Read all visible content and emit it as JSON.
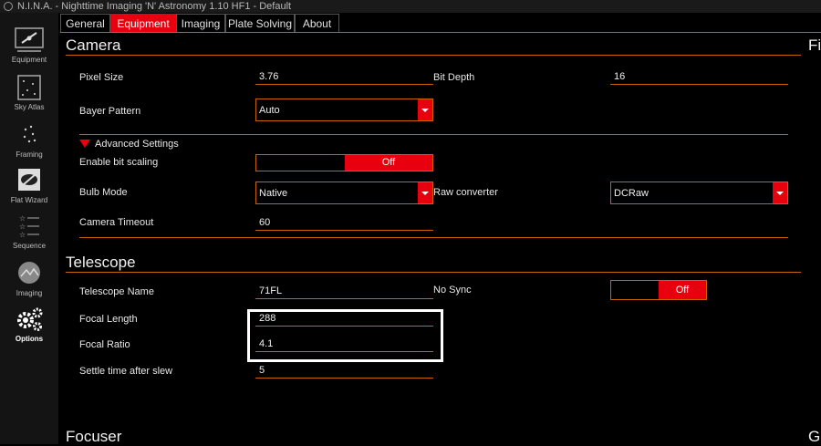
{
  "window": {
    "title": "N.I.N.A. - Nighttime Imaging 'N' Astronomy 1.10 HF1  -  Default"
  },
  "sidebar": {
    "items": [
      {
        "label": "Equipment",
        "icon": "telescope-icon"
      },
      {
        "label": "Sky Atlas",
        "icon": "star-map-icon"
      },
      {
        "label": "Framing",
        "icon": "framing-icon"
      },
      {
        "label": "Flat Wizard",
        "icon": "flat-wizard-icon"
      },
      {
        "label": "Sequence",
        "icon": "sequence-icon"
      },
      {
        "label": "Imaging",
        "icon": "imaging-icon"
      },
      {
        "label": "Options",
        "icon": "gears-icon",
        "active": true
      }
    ]
  },
  "tabs": [
    {
      "label": "General"
    },
    {
      "label": "Equipment",
      "active": true
    },
    {
      "label": "Imaging"
    },
    {
      "label": "Plate Solving"
    },
    {
      "label": "About"
    }
  ],
  "camera": {
    "title": "Camera",
    "pixel_size_label": "Pixel Size",
    "pixel_size": "3.76",
    "bit_depth_label": "Bit Depth",
    "bit_depth": "16",
    "bayer_label": "Bayer Pattern",
    "bayer": "Auto",
    "advanced_label": "Advanced Settings",
    "bit_scaling_label": "Enable bit scaling",
    "bit_scaling": "Off",
    "bulb_label": "Bulb Mode",
    "bulb": "Native",
    "raw_label": "Raw converter",
    "raw": "DCRaw",
    "timeout_label": "Camera Timeout",
    "timeout": "60"
  },
  "telescope": {
    "title": "Telescope",
    "name_label": "Telescope Name",
    "name": "71FL",
    "nosync_label": "No Sync",
    "nosync": "Off",
    "focal_length_label": "Focal Length",
    "focal_length": "288",
    "focal_ratio_label": "Focal Ratio",
    "focal_ratio": "4.1",
    "settle_label": "Settle time after slew",
    "settle": "5"
  },
  "focuser": {
    "title": "Focuser"
  },
  "right_cut": {
    "top": "Fi",
    "bottom": "G"
  },
  "colors": {
    "accent": "#e8000f",
    "border": "#c86400",
    "background": "#000000"
  }
}
